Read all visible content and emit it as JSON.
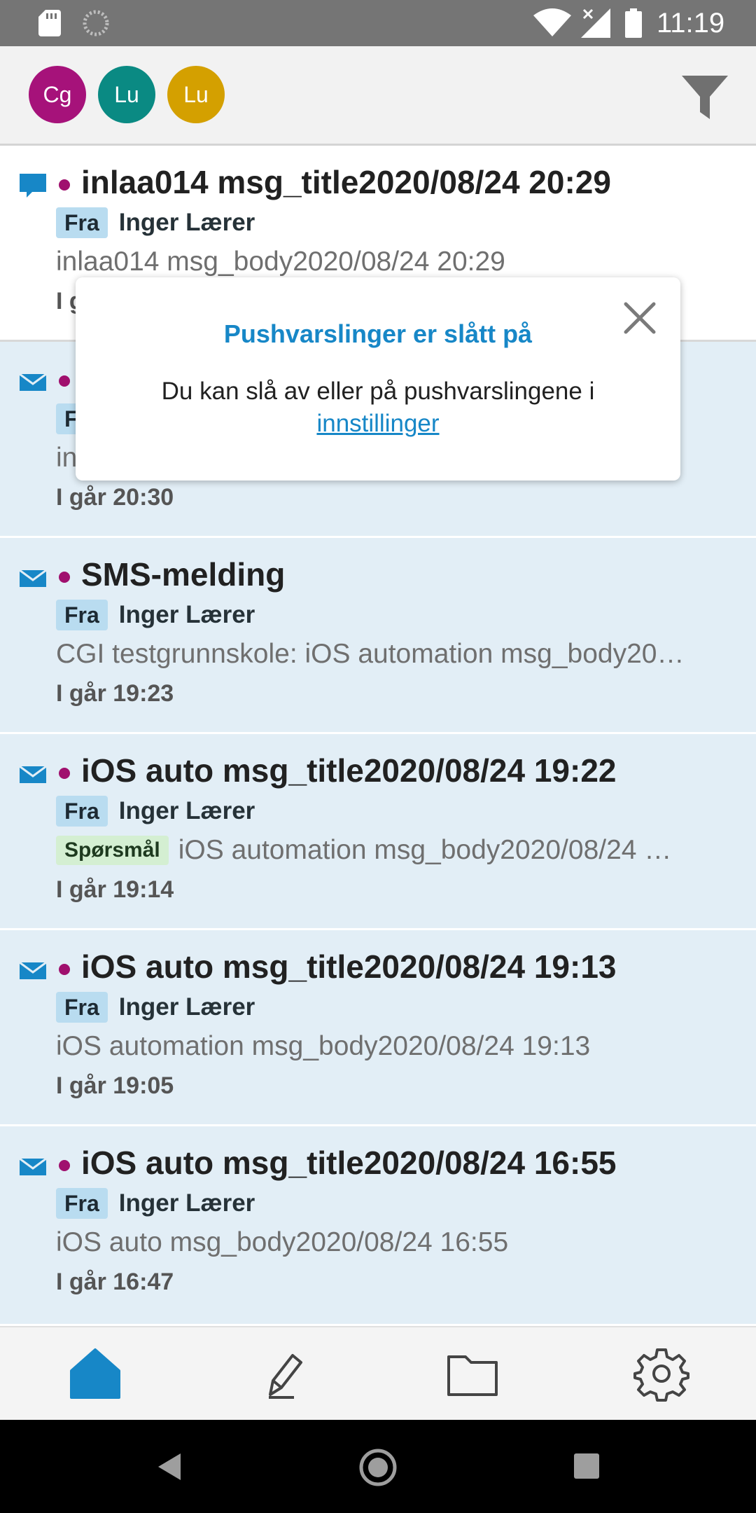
{
  "status_bar": {
    "time": "11:19",
    "icons": [
      "sd-card-icon",
      "sync-icon",
      "wifi-icon",
      "signal-icon",
      "battery-icon"
    ]
  },
  "header": {
    "avatars": [
      {
        "initials": "Cg",
        "color": "#a6127a"
      },
      {
        "initials": "Lu",
        "color": "#0a8a83"
      },
      {
        "initials": "Lu",
        "color": "#d4a000"
      }
    ],
    "filter_icon": "filter-icon"
  },
  "messages": [
    {
      "kind_icon": "chat-bubble-icon",
      "title": "inlaa014 msg_title2020/08/24 20:29",
      "from_label": "Fra",
      "sender": "Inger Lærer",
      "body": "inlaa014 msg_body2020/08/24 20:29",
      "date": "I g",
      "read": true
    },
    {
      "kind_icon": "envelope-icon",
      "title": "",
      "from_label": "F",
      "sender": "",
      "body": "in",
      "date": "I går 20:30",
      "read": false
    },
    {
      "kind_icon": "envelope-icon",
      "title": "SMS-melding",
      "from_label": "Fra",
      "sender": "Inger Lærer",
      "body": "CGI testgrunnskole: iOS automation msg_body20…",
      "date": "I går 19:23",
      "read": false
    },
    {
      "kind_icon": "envelope-icon",
      "title": "iOS auto msg_title2020/08/24 19:22",
      "from_label": "Fra",
      "sender": "Inger Lærer",
      "question_tag": "Spørsmål",
      "body": "iOS automation msg_body2020/08/24 …",
      "date": "I går 19:14",
      "read": false
    },
    {
      "kind_icon": "envelope-icon",
      "title": "iOS auto msg_title2020/08/24 19:13",
      "from_label": "Fra",
      "sender": "Inger Lærer",
      "body": "iOS automation msg_body2020/08/24 19:13",
      "date": "I går 19:05",
      "read": false
    },
    {
      "kind_icon": "envelope-icon",
      "title": "iOS auto msg_title2020/08/24 16:55",
      "from_label": "Fra",
      "sender": "Inger Lærer",
      "body": "iOS auto msg_body2020/08/24 16:55",
      "date": "I går 16:47",
      "read": false
    }
  ],
  "popup": {
    "title": "Pushvarslinger er slått på",
    "text": "Du kan slå av eller på pushvarslingene i",
    "link": "innstillinger"
  },
  "bottom_nav": {
    "items": [
      "home-icon",
      "compose-icon",
      "folder-icon",
      "settings-icon"
    ],
    "active_color": "#1787c7"
  },
  "system_nav": [
    "back-icon",
    "home-circle-icon",
    "recents-icon"
  ]
}
